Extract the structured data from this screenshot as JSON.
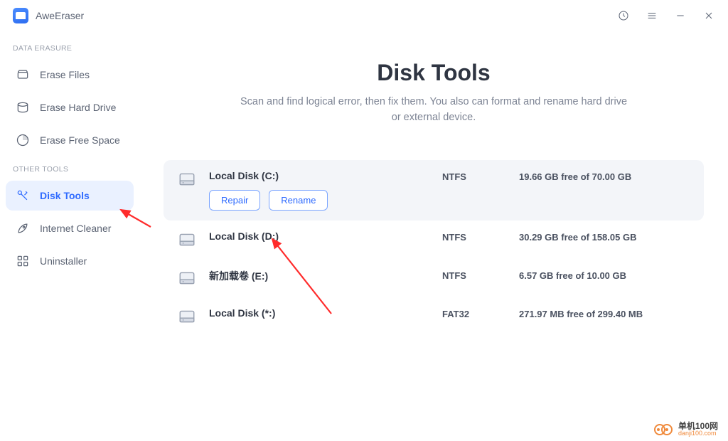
{
  "app": {
    "name": "AweEraser"
  },
  "sidebar": {
    "section1_label": "DATA ERASURE",
    "section2_label": "OTHER TOOLS",
    "items": {
      "erase_files": "Erase Files",
      "erase_hard_drive": "Erase Hard Drive",
      "erase_free_space": "Erase Free Space",
      "disk_tools": "Disk Tools",
      "internet_cleaner": "Internet Cleaner",
      "uninstaller": "Uninstaller"
    }
  },
  "page": {
    "title": "Disk Tools",
    "subtitle": "Scan and find logical error, then fix them. You also can format and rename hard drive or external device."
  },
  "actions": {
    "repair": "Repair",
    "rename": "Rename"
  },
  "disks": [
    {
      "name": "Local Disk (C:)",
      "fs": "NTFS",
      "free": "19.66 GB free of 70.00 GB",
      "active": true
    },
    {
      "name": "Local Disk (D:)",
      "fs": "NTFS",
      "free": "30.29 GB free of 158.05 GB",
      "active": false
    },
    {
      "name": "新加载卷 (E:)",
      "fs": "NTFS",
      "free": "6.57 GB free of 10.00 GB",
      "active": false
    },
    {
      "name": "Local Disk (*:)",
      "fs": "FAT32",
      "free": "271.97 MB free of 299.40 MB",
      "active": false
    }
  ],
  "watermark": {
    "top": "单机100网",
    "bottom": "danji100.com"
  }
}
